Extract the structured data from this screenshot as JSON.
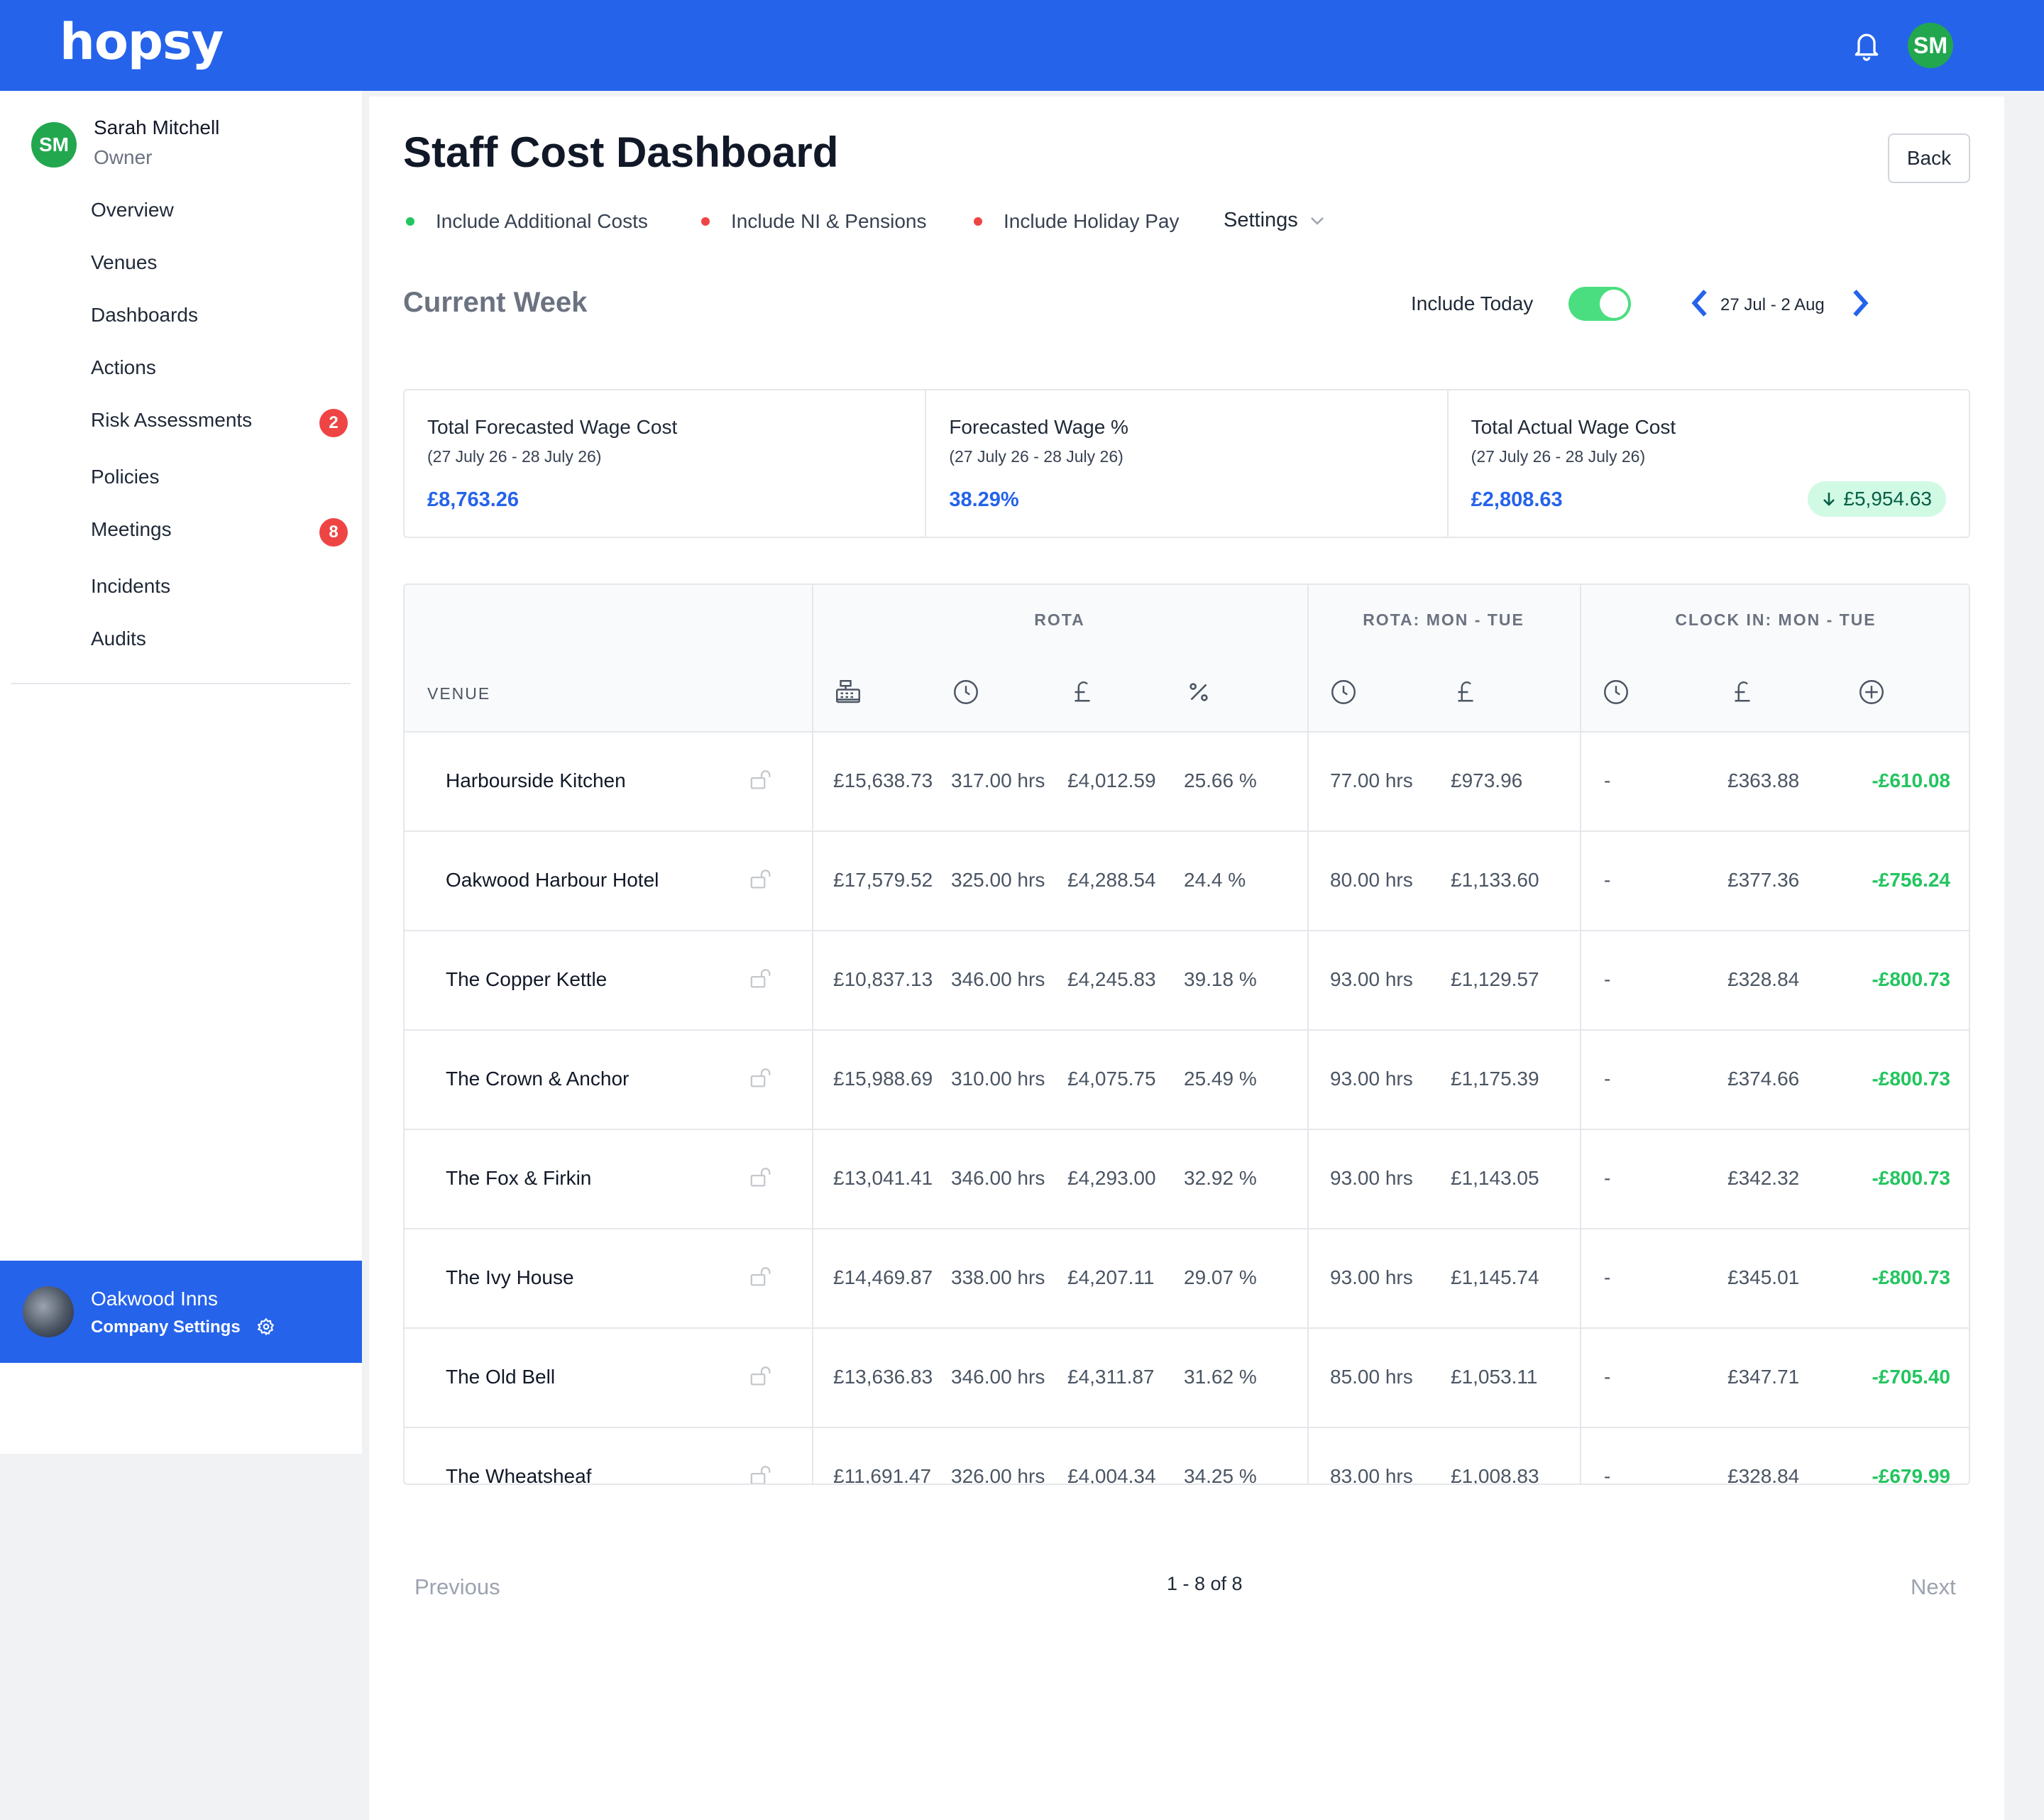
{
  "header": {
    "logo": "hopsy",
    "avatar_initials": "SM",
    "icons": [
      "bell-icon"
    ]
  },
  "user": {
    "initials": "SM",
    "name": "Sarah Mitchell",
    "role": "Owner"
  },
  "sidebar": {
    "items": [
      {
        "label": "Overview",
        "badge": ""
      },
      {
        "label": "Venues",
        "badge": ""
      },
      {
        "label": "Dashboards",
        "badge": ""
      },
      {
        "label": "Actions",
        "badge": ""
      },
      {
        "label": "Risk Assessments",
        "badge": "2"
      },
      {
        "label": "Policies",
        "badge": ""
      },
      {
        "label": "Meetings",
        "badge": "8"
      },
      {
        "label": "Incidents",
        "badge": ""
      },
      {
        "label": "Audits",
        "badge": ""
      }
    ],
    "company": {
      "name": "Oakwood Inns",
      "settings_label": "Company Settings"
    }
  },
  "page": {
    "title": "Staff Cost Dashboard",
    "back_label": "Back",
    "options": [
      {
        "label": "Include Additional Costs",
        "dot_color": "#22c55e"
      },
      {
        "label": "Include NI & Pensions",
        "dot_color": "#ef4444"
      },
      {
        "label": "Include Holiday Pay",
        "dot_color": "#ef4444"
      }
    ],
    "settings_label": "Settings",
    "week_title": "Current Week",
    "include_today_label": "Include Today",
    "include_today_on": true,
    "week_range": "27 Jul - 2 Aug"
  },
  "cards": [
    {
      "label": "Total Forecasted Wage Cost",
      "sub": "(27 July 26 - 28 July 26)",
      "value": "£8,763.26",
      "delta": ""
    },
    {
      "label": "Forecasted Wage %",
      "sub": "(27 July 26 - 28 July 26)",
      "value": "38.29%",
      "delta": ""
    },
    {
      "label": "Total Actual Wage Cost",
      "sub": "(27 July 26 - 28 July 26)",
      "value": "£2,808.63",
      "delta": "£5,954.63"
    }
  ],
  "table": {
    "groups": {
      "rota": "ROTA",
      "rota_mon_tue": "ROTA: MON - TUE",
      "clock_in": "CLOCK IN: MON - TUE"
    },
    "venue_header": "VENUE",
    "rows": [
      {
        "venue": "Harbourside Kitchen",
        "sales": "£15,638.73",
        "hrs": "317.00 hrs",
        "cost": "£4,012.59",
        "pct": "25.66 %",
        "mt_hrs": "77.00 hrs",
        "mt_cost": "£973.96",
        "ci_hrs": "-",
        "ci_cost": "£363.88",
        "ci_diff": "-£610.08"
      },
      {
        "venue": "Oakwood Harbour Hotel",
        "sales": "£17,579.52",
        "hrs": "325.00 hrs",
        "cost": "£4,288.54",
        "pct": "24.4 %",
        "mt_hrs": "80.00 hrs",
        "mt_cost": "£1,133.60",
        "ci_hrs": "-",
        "ci_cost": "£377.36",
        "ci_diff": "-£756.24"
      },
      {
        "venue": "The Copper Kettle",
        "sales": "£10,837.13",
        "hrs": "346.00 hrs",
        "cost": "£4,245.83",
        "pct": "39.18 %",
        "mt_hrs": "93.00 hrs",
        "mt_cost": "£1,129.57",
        "ci_hrs": "-",
        "ci_cost": "£328.84",
        "ci_diff": "-£800.73"
      },
      {
        "venue": "The Crown & Anchor",
        "sales": "£15,988.69",
        "hrs": "310.00 hrs",
        "cost": "£4,075.75",
        "pct": "25.49 %",
        "mt_hrs": "93.00 hrs",
        "mt_cost": "£1,175.39",
        "ci_hrs": "-",
        "ci_cost": "£374.66",
        "ci_diff": "-£800.73"
      },
      {
        "venue": "The Fox & Firkin",
        "sales": "£13,041.41",
        "hrs": "346.00 hrs",
        "cost": "£4,293.00",
        "pct": "32.92 %",
        "mt_hrs": "93.00 hrs",
        "mt_cost": "£1,143.05",
        "ci_hrs": "-",
        "ci_cost": "£342.32",
        "ci_diff": "-£800.73"
      },
      {
        "venue": "The Ivy House",
        "sales": "£14,469.87",
        "hrs": "338.00 hrs",
        "cost": "£4,207.11",
        "pct": "29.07 %",
        "mt_hrs": "93.00 hrs",
        "mt_cost": "£1,145.74",
        "ci_hrs": "-",
        "ci_cost": "£345.01",
        "ci_diff": "-£800.73"
      },
      {
        "venue": "The Old Bell",
        "sales": "£13,636.83",
        "hrs": "346.00 hrs",
        "cost": "£4,311.87",
        "pct": "31.62 %",
        "mt_hrs": "85.00 hrs",
        "mt_cost": "£1,053.11",
        "ci_hrs": "-",
        "ci_cost": "£347.71",
        "ci_diff": "-£705.40"
      },
      {
        "venue": "The Wheatsheaf",
        "sales": "£11,691.47",
        "hrs": "326.00 hrs",
        "cost": "£4,004.34",
        "pct": "34.25 %",
        "mt_hrs": "83.00 hrs",
        "mt_cost": "£1,008.83",
        "ci_hrs": "-",
        "ci_cost": "£328.84",
        "ci_diff": "-£679.99"
      }
    ]
  },
  "pager": {
    "prev_label": "Previous",
    "info": "1 - 8 of 8",
    "next_label": "Next"
  }
}
